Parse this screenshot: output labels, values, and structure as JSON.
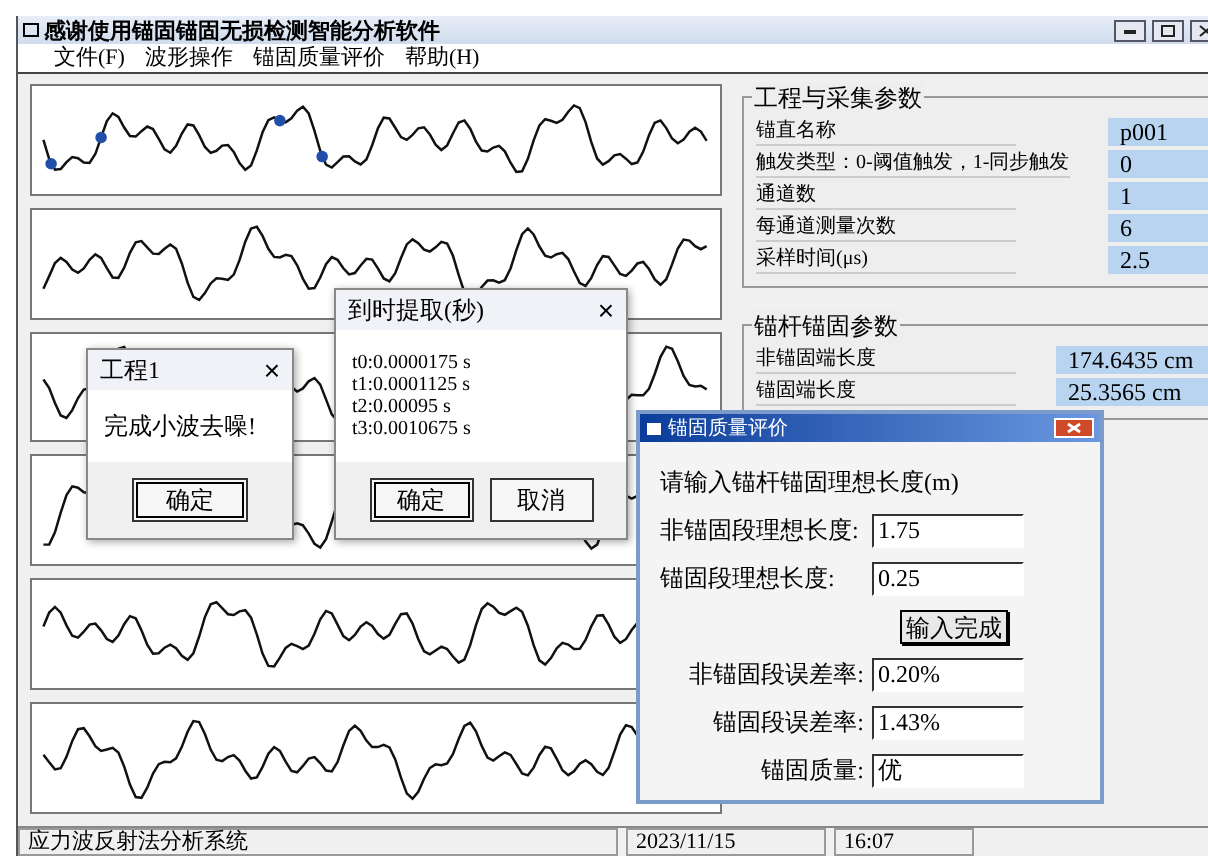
{
  "window": {
    "title": "感谢使用锚固锚固无损检测智能分析软件"
  },
  "menu": [
    "文件(F)",
    "波形操作",
    "锚固质量评价",
    "帮助(H)"
  ],
  "project_params": {
    "title": "工程与采集参数",
    "rows": [
      {
        "label": "锚直名称",
        "value": "p001"
      },
      {
        "label": "触发类型：0-阈值触发，1-同步触发",
        "value": "0"
      },
      {
        "label": "通道数",
        "value": "1"
      },
      {
        "label": "每通道测量次数",
        "value": "6"
      },
      {
        "label": "采样时间(μs)",
        "value": "2.5"
      }
    ]
  },
  "anchor_params": {
    "title": "锚杆锚固参数",
    "rows": [
      {
        "label": "非锚固端长度",
        "value": "174.6435 cm"
      },
      {
        "label": "锚固端长度",
        "value": "25.3565 cm"
      }
    ]
  },
  "denoise_dialog": {
    "title": "工程1",
    "close": "×",
    "message": "完成小波去噪!",
    "buttons": [
      "确定"
    ]
  },
  "arrival_dialog": {
    "title": "到时提取(秒)",
    "close": "×",
    "lines": [
      "t0:0.0000175 s",
      "t1:0.0001125 s",
      "t2:0.00095 s",
      "t3:0.0010675 s"
    ],
    "buttons": [
      "确定",
      "取消"
    ]
  },
  "quality_dialog": {
    "title": "锚固质量评价",
    "prompt": "请输入锚杆锚固理想长度(m)",
    "inputs": [
      {
        "label": "非锚固段理想长度:",
        "value": "1.75"
      },
      {
        "label": "锚固段理想长度:",
        "value": "0.25"
      }
    ],
    "submit": "输入完成",
    "results": [
      {
        "label": "非锚固段误差率:",
        "value": "0.20%"
      },
      {
        "label": "锚固段误差率:",
        "value": "1.43%"
      },
      {
        "label": "锚固质量:",
        "value": "优"
      }
    ]
  },
  "status_bar": {
    "message": "应力波反射法分析系统",
    "date": "2023/11/15",
    "time": "16:07"
  }
}
